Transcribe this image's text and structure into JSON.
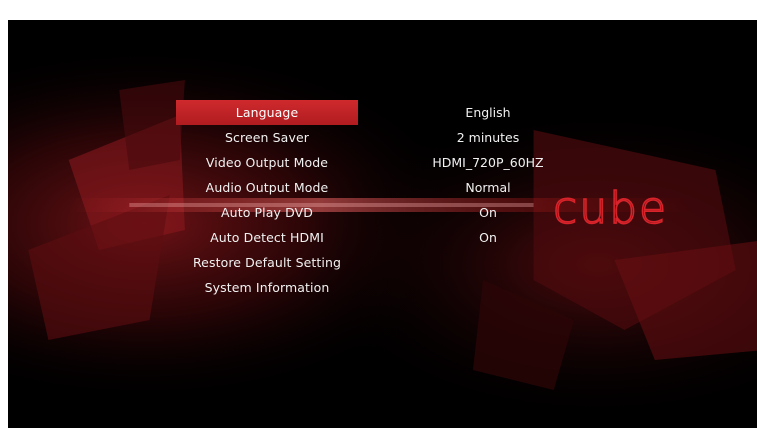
{
  "logo": {
    "text": "cube"
  },
  "menu": {
    "selected_index": 0,
    "items": [
      {
        "label": "Language",
        "value": "English"
      },
      {
        "label": "Screen Saver",
        "value": "2 minutes"
      },
      {
        "label": "Video Output Mode",
        "value": "HDMI_720P_60HZ"
      },
      {
        "label": "Audio Output Mode",
        "value": "Normal"
      },
      {
        "label": "Auto Play DVD",
        "value": "On"
      },
      {
        "label": "Auto Detect HDMI",
        "value": "On"
      },
      {
        "label": "Restore Default Setting",
        "value": ""
      },
      {
        "label": "System Information",
        "value": ""
      }
    ]
  },
  "colors": {
    "accent": "#c8262b",
    "text": "#f2f2f2",
    "background": "#000000"
  }
}
